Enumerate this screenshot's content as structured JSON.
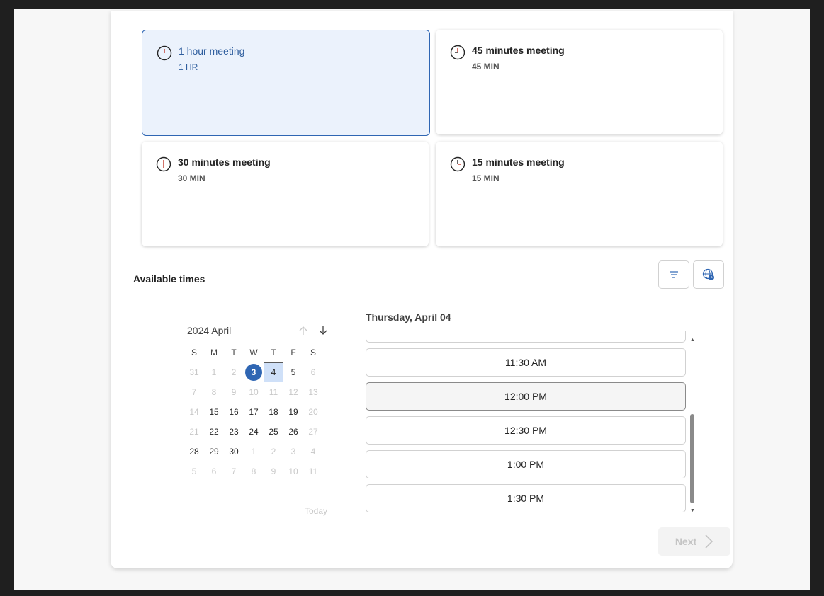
{
  "meeting_types": [
    {
      "title": "1 hour meeting",
      "duration": "1 HR",
      "selected": true
    },
    {
      "title": "45 minutes meeting",
      "duration": "45 MIN",
      "selected": false
    },
    {
      "title": "30 minutes meeting",
      "duration": "30 MIN",
      "selected": false
    },
    {
      "title": "15 minutes meeting",
      "duration": "15 MIN",
      "selected": false
    }
  ],
  "available_times_label": "Available times",
  "toolbar": {
    "filter_icon": "filter-icon",
    "timezone_icon": "globe-clock-icon"
  },
  "calendar": {
    "month_label": "2024 April",
    "weekdays": [
      "S",
      "M",
      "T",
      "W",
      "T",
      "F",
      "S"
    ],
    "weeks": [
      [
        "31",
        "1",
        "2",
        "3",
        "4",
        "5",
        "6"
      ],
      [
        "7",
        "8",
        "9",
        "10",
        "11",
        "12",
        "13"
      ],
      [
        "14",
        "15",
        "16",
        "17",
        "18",
        "19",
        "20"
      ],
      [
        "21",
        "22",
        "23",
        "24",
        "25",
        "26",
        "27"
      ],
      [
        "28",
        "29",
        "30",
        "1",
        "2",
        "3",
        "4"
      ],
      [
        "5",
        "6",
        "7",
        "8",
        "9",
        "10",
        "11"
      ]
    ],
    "today": "3",
    "selected": "4",
    "today_link": "Today"
  },
  "day_label": "Thursday, April 04",
  "time_slots": [
    "11:30 AM",
    "12:00 PM",
    "12:30 PM",
    "1:00 PM",
    "1:30 PM"
  ],
  "next_label": "Next",
  "accent_color": "#2f66b3"
}
